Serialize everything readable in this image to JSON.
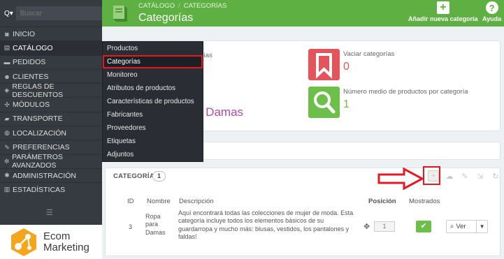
{
  "sidebar": {
    "search_placeholder": "Buscar",
    "search_type": "Q▾",
    "items": [
      {
        "label": "INICIO",
        "icon": "dashboard-icon"
      },
      {
        "label": "CATÁLOGO",
        "icon": "catalog-icon"
      },
      {
        "label": "PEDIDOS",
        "icon": "orders-icon"
      },
      {
        "label": "CLIENTES",
        "icon": "customers-icon"
      },
      {
        "label": "REGLAS DE DESCUENTOS",
        "icon": "discount-icon"
      },
      {
        "label": "MÓDULOS",
        "icon": "modules-icon"
      },
      {
        "label": "TRANSPORTE",
        "icon": "shipping-icon"
      },
      {
        "label": "LOCALIZACIÓN",
        "icon": "globe-icon"
      },
      {
        "label": "PREFERENCIAS",
        "icon": "wrench-icon"
      },
      {
        "label": "PARÁMETROS AVANZADOS",
        "icon": "cogs-icon"
      },
      {
        "label": "ADMINISTRACIÓN",
        "icon": "gear-icon"
      },
      {
        "label": "ESTADÍSTICAS",
        "icon": "stats-icon"
      }
    ],
    "logo": {
      "line1": "Ecom",
      "line2": "Marketing"
    }
  },
  "submenu": {
    "items": [
      "Productos",
      "Categorías",
      "Monitoreo",
      "Atributos de productos",
      "Características de productos",
      "Fabricantes",
      "Proveedores",
      "Etiquetas",
      "Adjuntos"
    ]
  },
  "header": {
    "breadcrumb_1": "CATÁLOGO",
    "breadcrumb_sep": "/",
    "breadcrumb_2": "CATEGORÍAS",
    "title": "Categorías",
    "add_label": "Añadir nueva categoría",
    "help_label": "Ayuda"
  },
  "kpis": {
    "partial_label": "rías",
    "partial_value": "a Damas",
    "empty_label": "Vaciar categorías",
    "empty_value": "0",
    "avg_label": "Número medio de productos por categoría",
    "avg_value": "1"
  },
  "categories": {
    "title": "CATEGORÍAS",
    "count": "1",
    "columns": {
      "id": "ID",
      "name": "Nombre",
      "description": "Descripción",
      "position": "Posición",
      "shown": "Mostrados"
    },
    "row": {
      "id": "3",
      "name_1": "Ropa",
      "name_2": "para",
      "name_3": "Damas",
      "desc_1": "Aquí encontrará todas las colecciones de mujer de moda. Esta",
      "desc_2": "categoría incluye todos los elementos básicos de su",
      "desc_3": "guardarropa y mucho más: blusas, vestidos, los pantalones y",
      "desc_4": "faldas!",
      "position": "1",
      "view_label": "Ver"
    }
  },
  "colors": {
    "green": "#5eb043",
    "sidebar": "#363a41",
    "red": "#e21b22",
    "kpi_red": "#e5535b",
    "kpi_green": "#6cc04a",
    "magenta": "#b04aa6"
  }
}
